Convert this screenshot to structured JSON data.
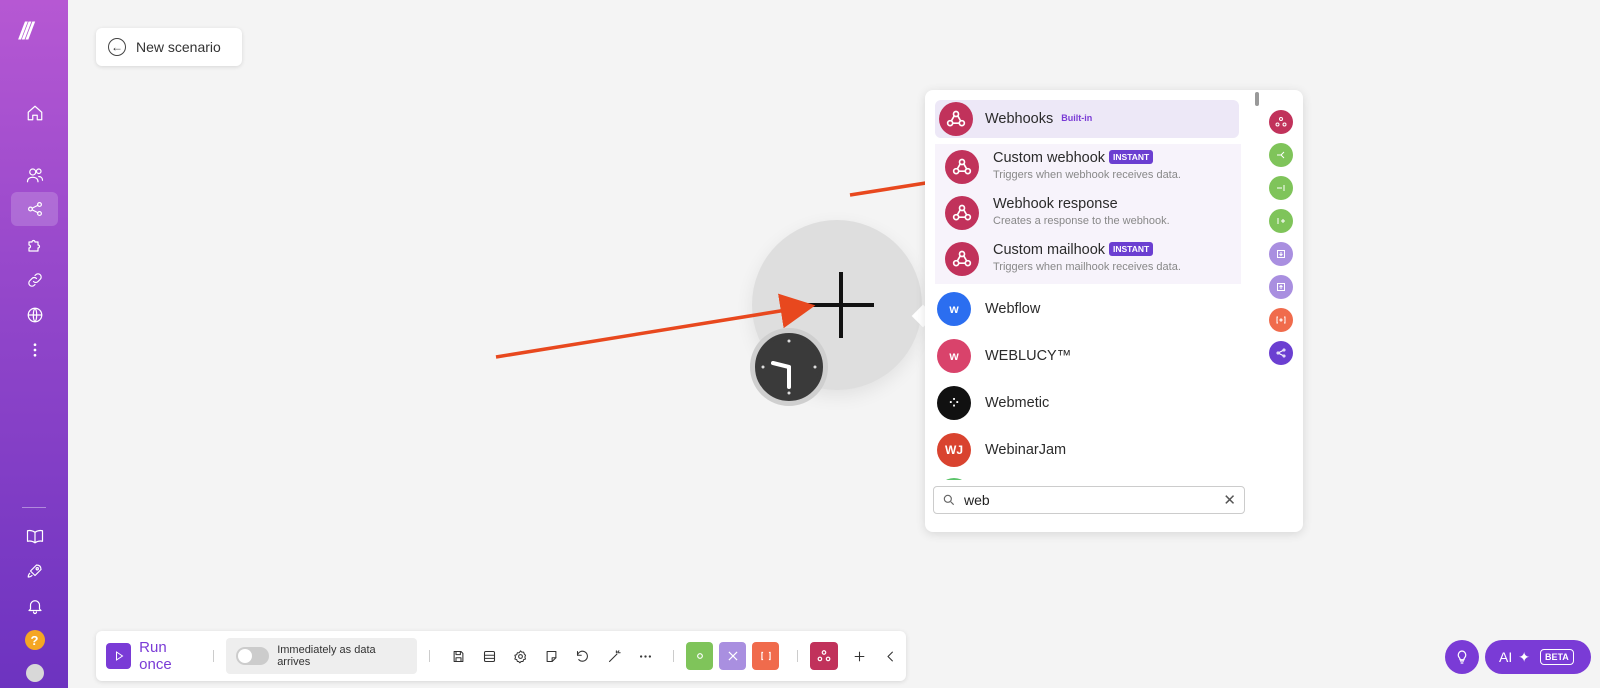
{
  "header": {
    "back_label": "New scenario"
  },
  "popup": {
    "main_app": {
      "name": "Webhooks",
      "badge": "Built-in"
    },
    "modules": [
      {
        "title": "Custom webhook",
        "badge": "INSTANT",
        "desc": "Triggers when webhook receives data."
      },
      {
        "title": "Webhook response",
        "badge": "",
        "desc": "Creates a response to the webhook."
      },
      {
        "title": "Custom mailhook",
        "badge": "INSTANT",
        "desc": "Triggers when mailhook receives data."
      }
    ],
    "apps": [
      {
        "name": "Webflow",
        "icon_text": "w",
        "color": "#2b6ef0"
      },
      {
        "name": "WEBLUCY™",
        "icon_text": "w",
        "color": "#d9436b"
      },
      {
        "name": "Webmetic",
        "icon_text": "⁘",
        "color": "#111111"
      },
      {
        "name": "WebinarJam",
        "icon_text": "WJ",
        "color": "#d9432f"
      }
    ],
    "search": {
      "value": "web",
      "clear_label": "✕"
    }
  },
  "toolbar": {
    "run_label": "Run once",
    "schedule_label": "Immediately as data arrives"
  },
  "ai": {
    "label": "AI",
    "beta": "BETA"
  },
  "colors": {
    "accent": "#7a3bd6",
    "webhook": "#c1325b",
    "arrow": "#e8481e"
  }
}
